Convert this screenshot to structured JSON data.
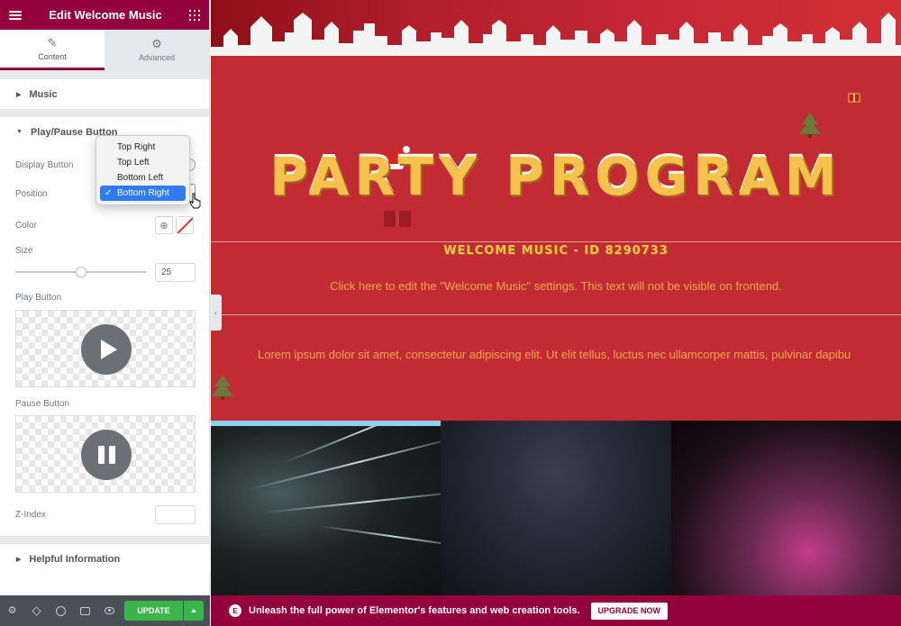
{
  "panel": {
    "title": "Edit Welcome Music",
    "tabs": [
      {
        "label": "Content",
        "icon": "pencil-icon",
        "active": true
      },
      {
        "label": "Advanced",
        "icon": "gear-icon",
        "active": false
      }
    ],
    "sections": {
      "music": {
        "label": "Music",
        "expanded": false
      },
      "play_pause": {
        "label": "Play/Pause Button",
        "expanded": true
      },
      "helpful": {
        "label": "Helpful Information",
        "expanded": false
      }
    },
    "controls": {
      "display_button": "Display Button",
      "position": "Position",
      "color": "Color",
      "size": "Size",
      "size_value": "25",
      "size_fraction": 0.5,
      "play_button": "Play Button",
      "pause_button": "Pause Button",
      "z_index": "Z-Index",
      "z_index_value": ""
    },
    "position_dropdown": {
      "options": [
        "Top Right",
        "Top Left",
        "Bottom Left",
        "Bottom Right"
      ],
      "selected": "Bottom Right",
      "check_mark": "✓"
    },
    "footer": {
      "icons": [
        "settings-icon",
        "layers-icon",
        "history-icon",
        "responsive-icon",
        "preview-eye-icon"
      ],
      "update_label": "UPDATE"
    }
  },
  "preview": {
    "headline": "PARTY PROGRAM",
    "music_id": "WELCOME MUSIC - ID 8290733",
    "edit_hint": "Click here to edit the \"Welcome Music\" settings. This text will not be visible on frontend.",
    "lorem": "Lorem ipsum dolor sit amet, consectetur adipiscing elit. Ut elit tellus, luctus nec ullamcorper mattis, pulvinar dapibu",
    "colors": {
      "background": "#c22b33",
      "headline": "#f5c24c",
      "body_text": "#f0a84f",
      "accent": "#93003c",
      "update_green": "#39b54a"
    }
  },
  "promo": {
    "logo": "E",
    "text": "Unleash the full power of Elementor's features and web creation tools.",
    "button": "UPGRADE NOW"
  }
}
